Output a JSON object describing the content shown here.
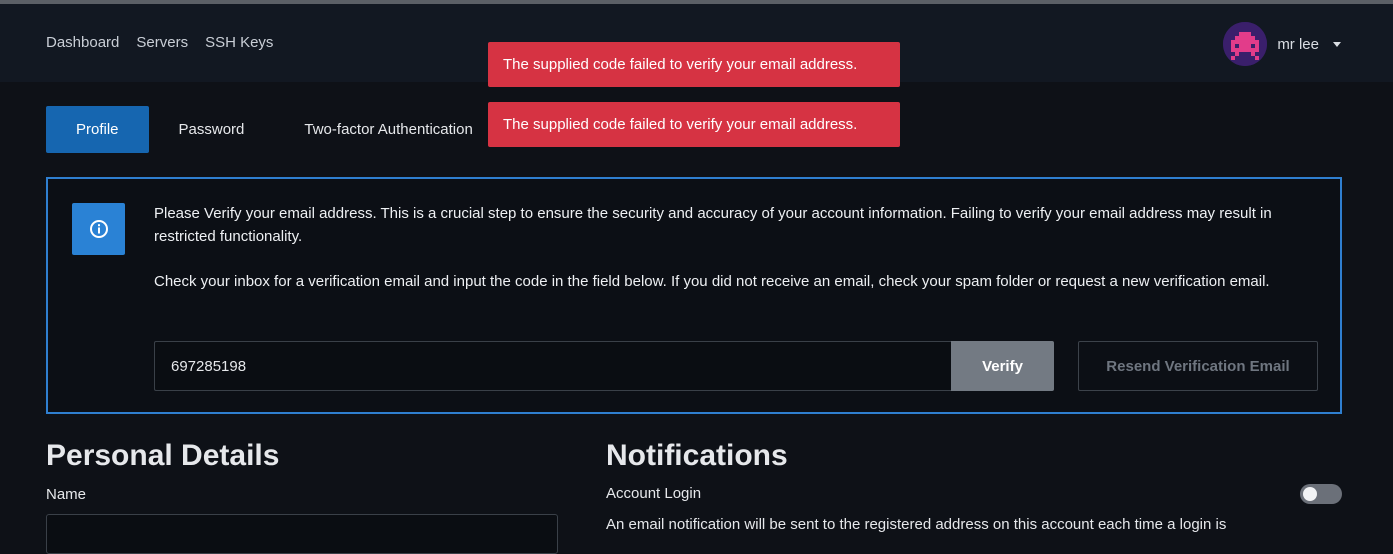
{
  "nav": {
    "items": [
      "Dashboard",
      "Servers",
      "SSH Keys"
    ]
  },
  "user": {
    "name": "mr lee"
  },
  "toasts": [
    "The supplied code failed to verify your email address.",
    "The supplied code failed to verify your email address."
  ],
  "tabs": [
    {
      "label": "Profile",
      "active": true
    },
    {
      "label": "Password",
      "active": false
    },
    {
      "label": "Two-factor Authentication",
      "active": false
    }
  ],
  "verify": {
    "message1": "Please Verify your email address. This is a crucial step to ensure the security and accuracy of your account information. Failing to verify your email address may result in restricted functionality.",
    "message2": "Check your inbox for a verification email and input the code in the field below. If you did not receive an email, check your spam folder or request a new verification email.",
    "code_value": "697285198",
    "verify_label": "Verify",
    "resend_label": "Resend Verification Email"
  },
  "personal": {
    "heading": "Personal Details",
    "name_label": "Name"
  },
  "notifications": {
    "heading": "Notifications",
    "account_login_label": "Account Login",
    "account_login_enabled": false,
    "description": "An email notification will be sent to the registered address on this account each time a login is"
  },
  "colors": {
    "accent": "#1666b0",
    "info": "#2a82d5",
    "danger": "#d63343",
    "background": "#0e1117"
  },
  "icons": {
    "info": "info-circle-icon",
    "avatar": "pixel-invader-avatar",
    "caret": "caret-down-icon"
  }
}
